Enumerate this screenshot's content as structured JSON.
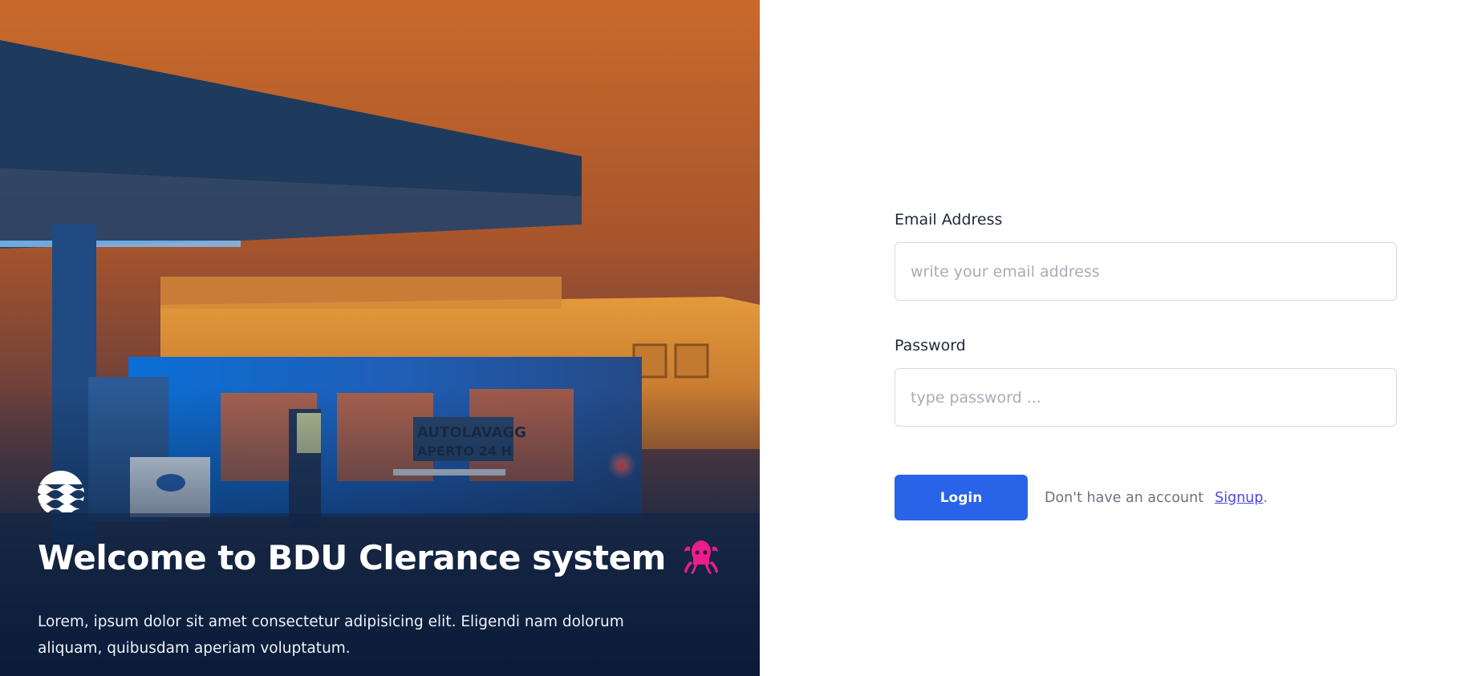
{
  "hero": {
    "title": "Welcome to BDU Clerance system",
    "description": "Lorem, ipsum dolor sit amet consectetur adipisicing elit. Eligendi nam dolorum aliquam, quibusdam aperiam voluptatum.",
    "logo_icon": "waves-icon",
    "mascot_icon": "octopus-icon",
    "mascot_color": "#e91e8c"
  },
  "form": {
    "email_label": "Email Address",
    "email_placeholder": "write your email address",
    "email_value": "",
    "password_label": "Password",
    "password_placeholder": "type password ...",
    "password_value": "",
    "login_label": "Login",
    "no_account_text": "Don't have an account",
    "signup_label": "Signup",
    "signup_suffix": "."
  },
  "colors": {
    "primary": "#2863e8",
    "link": "#4f46e5"
  }
}
